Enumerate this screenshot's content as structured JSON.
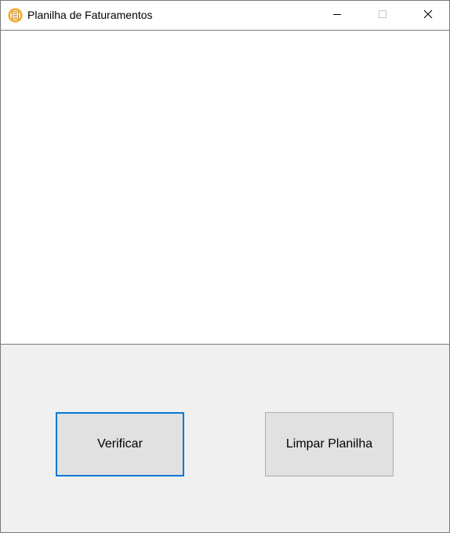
{
  "window": {
    "title": "Planilha de Faturamentos",
    "icon": "spreadsheet-app-icon",
    "controls": {
      "minimize_icon": "minimize-icon",
      "maximize_icon": "maximize-icon",
      "close_icon": "close-icon"
    }
  },
  "buttons": {
    "verify_label": "Verificar",
    "clear_label": "Limpar Planilha"
  },
  "colors": {
    "accent": "#0078d7",
    "button_face": "#e1e1e1",
    "window_background": "#f0f0f0",
    "app_icon": "#f6a623"
  }
}
